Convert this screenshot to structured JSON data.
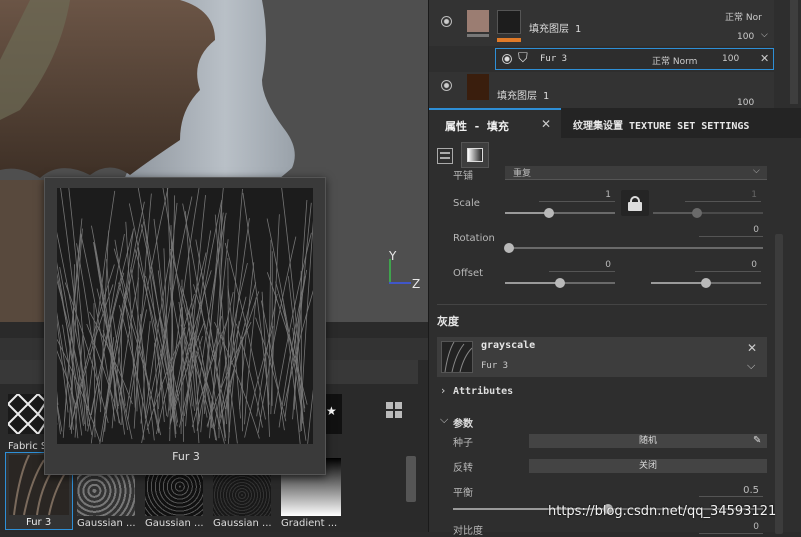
{
  "viewport": {
    "axis_y": "Y",
    "axis_z": "Z"
  },
  "preview": {
    "caption": "Fur 3"
  },
  "shelf": {
    "items": [
      {
        "label": "Fabric S"
      },
      {
        "label": "Fur 3"
      },
      {
        "label": "Gaussian ..."
      },
      {
        "label": "Gaussian ..."
      },
      {
        "label": "Gaussian ..."
      },
      {
        "label": "Gradient ..."
      }
    ]
  },
  "layers": {
    "layer1": {
      "name": "填充图层 1",
      "blend": "正常 Nor",
      "opacity": "100"
    },
    "effect": {
      "name": "Fur 3",
      "blend": "正常 Norm",
      "opacity": "100"
    },
    "layer2": {
      "name": "填充图层 1",
      "opacity": "100"
    }
  },
  "tabs": {
    "properties": "属性 - 填充",
    "texture_set": "纹理集设置 TEXTURE SET SETTINGS"
  },
  "props": {
    "projection_label": "平铺",
    "projection_value": "重复",
    "scale_label": "Scale",
    "scale_value": "1",
    "scale_value2": "1",
    "scale_level": 0.4,
    "scale_level2": 0.4,
    "rotation_label": "Rotation",
    "rotation_value": "0",
    "rotation_level": 0,
    "offset_label": "Offset",
    "offset_x": "0",
    "offset_y": "0",
    "offset_x_level": 0.5,
    "offset_y_level": 0.5
  },
  "grayscale": {
    "section": "灰度",
    "title": "grayscale",
    "resource": "Fur 3",
    "attributes": "Attributes",
    "params": "参数",
    "seed_label": "种子",
    "seed_value": "随机",
    "invert_label": "反转",
    "invert_value": "关闭",
    "balance_label": "平衡",
    "balance_value": "0.5",
    "balance_level": 0.5,
    "contrast_label": "对比度",
    "contrast_value": "0"
  },
  "watermark": "https://blog.csdn.net/qq_34593121",
  "colors": {
    "accent": "#2e8fd6",
    "orange": "#e07a28"
  }
}
